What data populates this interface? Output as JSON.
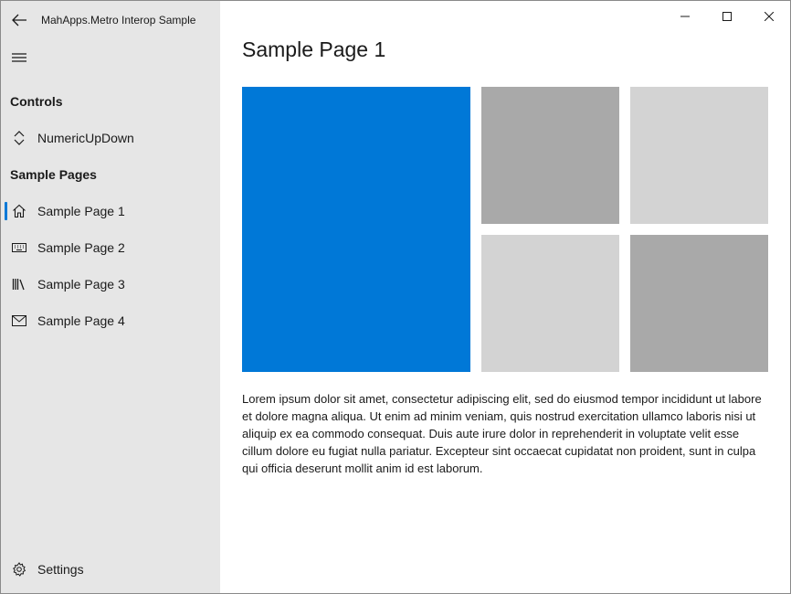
{
  "app": {
    "title": "MahApps.Metro Interop Sample"
  },
  "window_controls": {
    "minimize_icon": "minimize-icon",
    "maximize_icon": "maximize-icon",
    "close_icon": "close-icon"
  },
  "sidebar": {
    "sections": [
      {
        "header": "Controls",
        "items": [
          {
            "label": "NumericUpDown",
            "icon": "chevron-up-down-icon"
          }
        ]
      },
      {
        "header": "Sample Pages",
        "items": [
          {
            "label": "Sample Page 1",
            "icon": "home-icon",
            "selected": true
          },
          {
            "label": "Sample Page 2",
            "icon": "keyboard-icon"
          },
          {
            "label": "Sample Page 3",
            "icon": "library-icon"
          },
          {
            "label": "Sample Page 4",
            "icon": "mail-icon"
          }
        ]
      }
    ],
    "footer": {
      "label": "Settings",
      "icon": "gear-icon"
    }
  },
  "main": {
    "title": "Sample Page 1",
    "tiles": [
      {
        "name": "blue-tile",
        "color": "#0078d7"
      },
      {
        "name": "gray-tile-top-left",
        "color": "#a9a9a9"
      },
      {
        "name": "gray-tile-top-right",
        "color": "#d3d3d3"
      },
      {
        "name": "gray-tile-bottom-left",
        "color": "#d3d3d3"
      },
      {
        "name": "gray-tile-bottom-right",
        "color": "#a9a9a9"
      }
    ],
    "body_text": "Lorem ipsum dolor sit amet, consectetur adipiscing elit, sed do eiusmod tempor incididunt ut labore et dolore magna aliqua. Ut enim ad minim veniam, quis nostrud exercitation ullamco laboris nisi ut aliquip ex ea commodo consequat. Duis aute irure dolor in reprehenderit in voluptate velit esse cillum dolore eu fugiat nulla pariatur. Excepteur sint occaecat cupidatat non proident, sunt in culpa qui officia deserunt mollit anim id est laborum."
  },
  "colors": {
    "accent": "#0078d7",
    "sidebar_bg": "#e6e6e6",
    "content_bg": "#ffffff"
  }
}
